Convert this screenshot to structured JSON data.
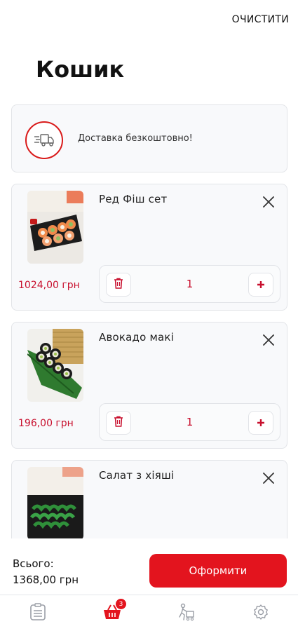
{
  "header": {
    "clear_label": "ОЧИСТИТИ",
    "title": "Кошик"
  },
  "delivery": {
    "text": "Доставка безкоштовно!",
    "icon": "delivery-truck-icon",
    "accent": "#d91a1a"
  },
  "items": [
    {
      "name": "Ред Фіш сет",
      "price": "1024,00 грн",
      "quantity": "1"
    },
    {
      "name": "Авокадо макі",
      "price": "196,00 грн",
      "quantity": "1"
    },
    {
      "name": "Салат з хіяші",
      "price": "",
      "quantity": ""
    }
  ],
  "summary": {
    "total_label": "Всього:",
    "total_value": "1368,00 грн",
    "checkout_label": "Оформити"
  },
  "nav": {
    "items": [
      {
        "icon": "menu-list-icon"
      },
      {
        "icon": "cart-icon",
        "badge": "3",
        "active": true
      },
      {
        "icon": "delivery-courier-icon"
      },
      {
        "icon": "settings-gear-icon"
      }
    ]
  },
  "colors": {
    "brand_red": "#e3141e",
    "price_red": "#c8102e",
    "inactive_icon": "#9a9ea6"
  }
}
